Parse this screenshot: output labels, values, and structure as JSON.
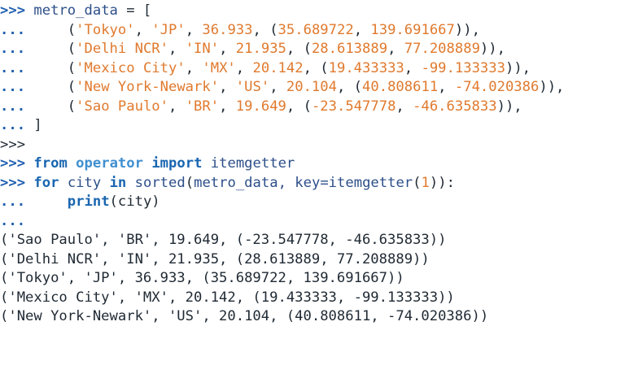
{
  "prompts": {
    "primary": ">>>",
    "continuation": "..."
  },
  "block1": {
    "l1": {
      "prompt": ">>>",
      "var": "metro_data",
      "op": " = ["
    },
    "rows": [
      {
        "prompt": "...",
        "indent": "     ",
        "open": "(",
        "s1": "'Tokyo'",
        "c1": ", ",
        "s2": "'JP'",
        "c2": ", ",
        "n1": "36.933",
        "c3": ", (",
        "n2": "35.689722",
        "c4": ", ",
        "n3": "139.691667",
        "close": ")),"
      },
      {
        "prompt": "...",
        "indent": "     ",
        "open": "(",
        "s1": "'Delhi NCR'",
        "c1": ", ",
        "s2": "'IN'",
        "c2": ", ",
        "n1": "21.935",
        "c3": ", (",
        "n2": "28.613889",
        "c4": ", ",
        "n3": "77.208889",
        "close": ")),"
      },
      {
        "prompt": "...",
        "indent": "     ",
        "open": "(",
        "s1": "'Mexico City'",
        "c1": ", ",
        "s2": "'MX'",
        "c2": ", ",
        "n1": "20.142",
        "c3": ", (",
        "n2": "19.433333",
        "c4": ", ",
        "n3": "-99.133333",
        "close": ")),"
      },
      {
        "prompt": "...",
        "indent": "     ",
        "open": "(",
        "s1": "'New York-Newark'",
        "c1": ", ",
        "s2": "'US'",
        "c2": ", ",
        "n1": "20.104",
        "c3": ", (",
        "n2": "40.808611",
        "c4": ", ",
        "n3": "-74.020386",
        "close": ")),"
      },
      {
        "prompt": "...",
        "indent": "     ",
        "open": "(",
        "s1": "'Sao Paulo'",
        "c1": ", ",
        "s2": "'BR'",
        "c2": ", ",
        "n1": "19.649",
        "c3": ", (",
        "n2": "-23.547778",
        "c4": ", ",
        "n3": "-46.635833",
        "close": ")),"
      }
    ],
    "closing": {
      "prompt": "...",
      "text": " ]"
    }
  },
  "blank_prompt": ">>>",
  "import_line": {
    "prompt": ">>>",
    "kw_from": "from",
    "module": "operator",
    "kw_import": "import",
    "name": "itemgetter"
  },
  "for_line": {
    "prompt": ">>>",
    "kw_for": "for",
    "var": "city",
    "kw_in": "in",
    "func": "sorted",
    "arg_open": "(",
    "arg1": "metro_data",
    "arg_sep": ", key=",
    "getter": "itemgetter",
    "getter_open": "(",
    "index": "1",
    "tail": ")):"
  },
  "print_line": {
    "prompt": "...",
    "indent": "     ",
    "func": "print",
    "args": "(city)"
  },
  "empty_cont": "...",
  "output": [
    "('Sao Paulo', 'BR', 19.649, (-23.547778, -46.635833))",
    "('Delhi NCR', 'IN', 21.935, (28.613889, 77.208889))",
    "('Tokyo', 'JP', 36.933, (35.689722, 139.691667))",
    "('Mexico City', 'MX', 20.142, (19.433333, -99.133333))",
    "('New York-Newark', 'US', 20.104, (40.808611, -74.020386))"
  ],
  "colors": {
    "prompt": "#1f5fb0",
    "keyword": "#1a66b0",
    "module": "#3f8fd0",
    "string_number": "#e07a2e",
    "identifier": "#2d4f8a",
    "plain": "#1f2933",
    "background": "#ffffff"
  }
}
